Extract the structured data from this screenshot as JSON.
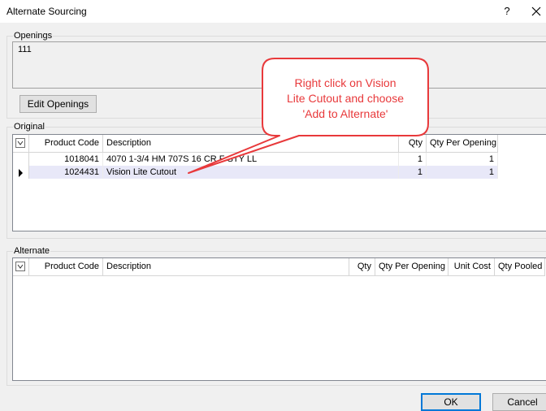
{
  "window": {
    "title": "Alternate Sourcing",
    "help_label": "?"
  },
  "openings": {
    "group_label": "Openings",
    "value": "111",
    "edit_button": "Edit Openings"
  },
  "original": {
    "group_label": "Original",
    "columns": [
      "Product Code",
      "Description",
      "Qty",
      "Qty Per Opening"
    ],
    "rows": [
      {
        "code": "1018041",
        "description": "4070 1-3/4 HM 707S 16 CR F STY LL",
        "qty": "1",
        "qty_per_opening": "1"
      },
      {
        "code": "1024431",
        "description": "Vision Lite Cutout",
        "qty": "1",
        "qty_per_opening": "1"
      }
    ],
    "selected_row": 1
  },
  "alternate": {
    "group_label": "Alternate",
    "columns": [
      "Product Code",
      "Description",
      "Qty",
      "Qty Per Opening",
      "Unit Cost",
      "Qty Pooled"
    ]
  },
  "callout": {
    "line1": "Right click on Vision",
    "line2": "Lite Cutout and choose",
    "line3": "'Add to Alternate'",
    "color": "#e8393b"
  },
  "footer": {
    "ok_label": "OK",
    "cancel_label": "Cancel"
  }
}
